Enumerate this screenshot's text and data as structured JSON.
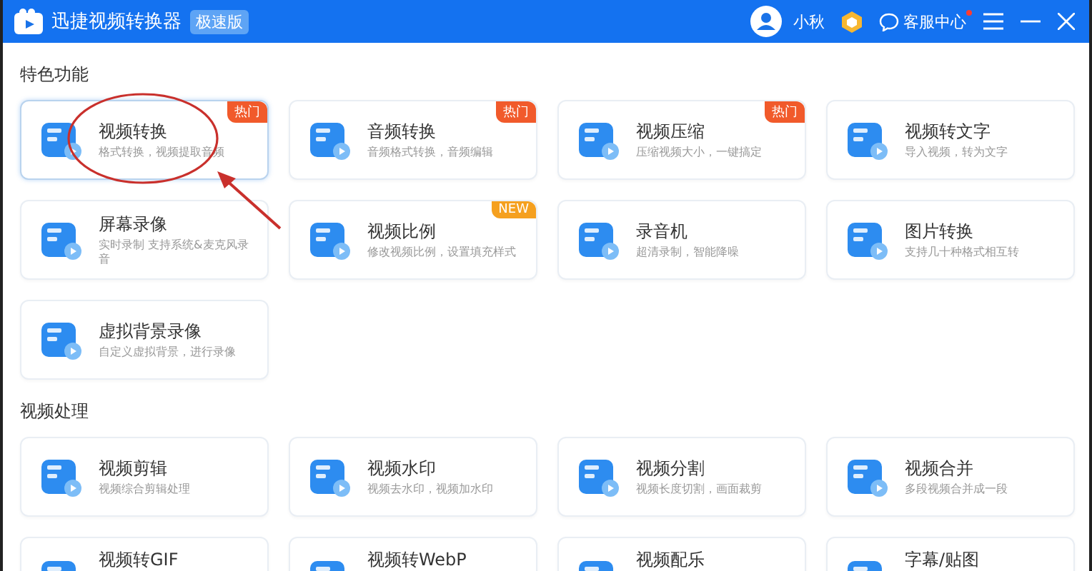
{
  "window": {
    "title": "迅捷视频转换器",
    "edition_badge": "极速版",
    "user": "小秋",
    "support": {
      "label": "客服中心",
      "unread": true
    }
  },
  "sections": [
    {
      "title": "特色功能",
      "cards": [
        {
          "title": "视频转换",
          "desc": "格式转换，视频提取音频",
          "badge": {
            "text": "热门",
            "color": "#f15a2b"
          },
          "selected": true
        },
        {
          "title": "音频转换",
          "desc": "音频格式转换，音频编辑",
          "badge": {
            "text": "热门",
            "color": "#f15a2b"
          },
          "selected": false
        },
        {
          "title": "视频压缩",
          "desc": "压缩视频大小，一键搞定",
          "badge": {
            "text": "热门",
            "color": "#f15a2b"
          },
          "selected": false
        },
        {
          "title": "视频转文字",
          "desc": "导入视频，转为文字",
          "selected": false
        },
        {
          "title": "屏幕录像",
          "desc": "实时录制 支持系统&麦克风录音",
          "selected": false
        },
        {
          "title": "视频比例",
          "desc": "修改视频比例，设置填充样式",
          "badge": {
            "text": "NEW",
            "color": "#f5a01f"
          },
          "selected": false
        },
        {
          "title": "录音机",
          "desc": "超清录制，智能降噪",
          "selected": false
        },
        {
          "title": "图片转换",
          "desc": "支持几十种格式相互转",
          "selected": false
        },
        {
          "title": "虚拟背景录像",
          "desc": "自定义虚拟背景，进行录像",
          "selected": false
        }
      ]
    },
    {
      "title": "视频处理",
      "cards": [
        {
          "title": "视频剪辑",
          "desc": "视频综合剪辑处理",
          "selected": false
        },
        {
          "title": "视频水印",
          "desc": "视频去水印，视频加水印",
          "selected": false
        },
        {
          "title": "视频分割",
          "desc": "视频长度切割，画面裁剪",
          "selected": false
        },
        {
          "title": "视频合并",
          "desc": "多段视频合并成一段",
          "selected": false
        },
        {
          "title": "视频转GIF",
          "selected": false
        },
        {
          "title": "视频转WebP",
          "selected": false
        },
        {
          "title": "视频配乐",
          "selected": false
        },
        {
          "title": "字幕/贴图",
          "selected": false
        }
      ]
    }
  ]
}
